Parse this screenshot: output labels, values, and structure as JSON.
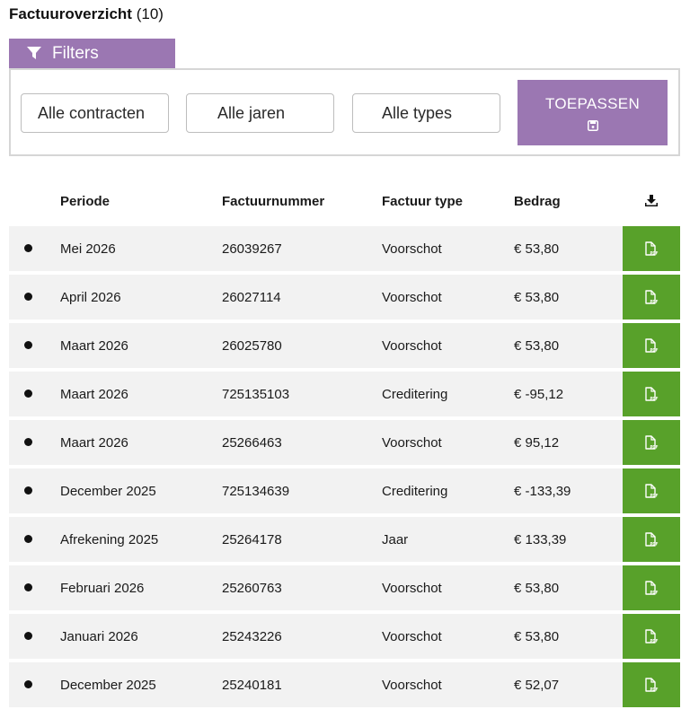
{
  "header": {
    "title": "Factuuroverzicht",
    "count": "(10)"
  },
  "filters": {
    "tab_label": "Filters",
    "contract_select": "Alle contracten",
    "year_select": "Alle jaren",
    "type_select": "Alle types",
    "apply_label": "TOEPASSEN"
  },
  "table": {
    "columns": {
      "periode": "Periode",
      "factuurnummer": "Factuurnummer",
      "type": "Factuur type",
      "bedrag": "Bedrag"
    },
    "rows": [
      {
        "periode": "Mei 2026",
        "nr": "26039267",
        "type": "Voorschot",
        "bedrag": "€ 53,80"
      },
      {
        "periode": "April 2026",
        "nr": "26027114",
        "type": "Voorschot",
        "bedrag": "€ 53,80"
      },
      {
        "periode": "Maart 2026",
        "nr": "26025780",
        "type": "Voorschot",
        "bedrag": "€ 53,80"
      },
      {
        "periode": "Maart 2026",
        "nr": "725135103",
        "type": "Creditering",
        "bedrag": "€ -95,12"
      },
      {
        "periode": "Maart 2026",
        "nr": "25266463",
        "type": "Voorschot",
        "bedrag": "€ 95,12"
      },
      {
        "periode": "December 2025",
        "nr": "725134639",
        "type": "Creditering",
        "bedrag": "€ -133,39"
      },
      {
        "periode": "Afrekening 2025",
        "nr": "25264178",
        "type": "Jaar",
        "bedrag": "€ 133,39"
      },
      {
        "periode": "Februari 2026",
        "nr": "25260763",
        "type": "Voorschot",
        "bedrag": "€ 53,80"
      },
      {
        "periode": "Januari 2026",
        "nr": "25243226",
        "type": "Voorschot",
        "bedrag": "€ 53,80"
      },
      {
        "periode": "December 2025",
        "nr": "25240181",
        "type": "Voorschot",
        "bedrag": "€ 52,07"
      }
    ]
  },
  "colors": {
    "accent": "#9b77b2",
    "download": "#58a12a",
    "row_bg": "#f2f2f2"
  },
  "icons": {
    "filter": "filter-icon",
    "save": "save-icon",
    "download": "download-icon",
    "pdf": "pdf-file-icon"
  }
}
